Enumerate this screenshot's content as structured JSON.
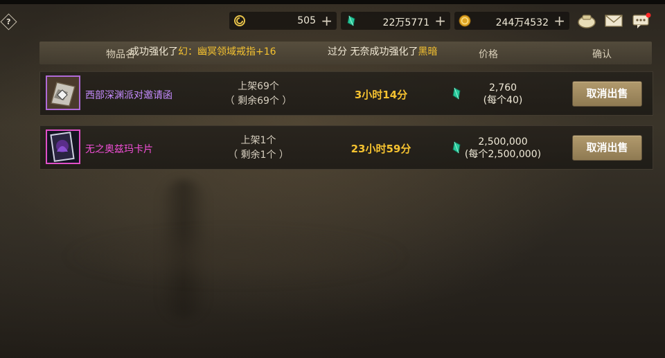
{
  "topbar": {
    "currencies": [
      {
        "icon": "spiral-coin-icon",
        "value": "505"
      },
      {
        "icon": "green-gem-icon",
        "value": "22万5771"
      },
      {
        "icon": "gold-coin-icon",
        "value": "244万4532"
      }
    ],
    "plus": "+",
    "help": "?",
    "icons": [
      "pouch-icon",
      "mail-icon",
      "chat-notification-icon"
    ]
  },
  "header": {
    "col_item": "物品名",
    "col_price": "价格",
    "col_confirm": "确认",
    "notice": {
      "part1": "成功强化了",
      "item1": "幻：幽冥领域戒指",
      "level1": "+16",
      "mid": "过分",
      "part2": "无奈成功强化了",
      "item2": "黑暗"
    }
  },
  "rows": [
    {
      "name": "西部深渊派对邀请函",
      "stock_line1": "上架69个",
      "stock_line2": "（ 剩余69个 ）",
      "time_left": "3小时14分",
      "price": "2,760",
      "unit_price": "(每个40)",
      "action": "取消出售"
    },
    {
      "name": "无之奥兹玛卡片",
      "stock_line1": "上架1个",
      "stock_line2": "（ 剩余1个 ）",
      "time_left": "23小时59分",
      "price": "2,500,000",
      "unit_price": "(每个2,500,000)",
      "action": "取消出售"
    }
  ],
  "colors": {
    "accent_gold": "#f5c230",
    "rare_violet": "#c58cff",
    "epic_magenta": "#f24fd8",
    "button": "#a08a5e"
  }
}
